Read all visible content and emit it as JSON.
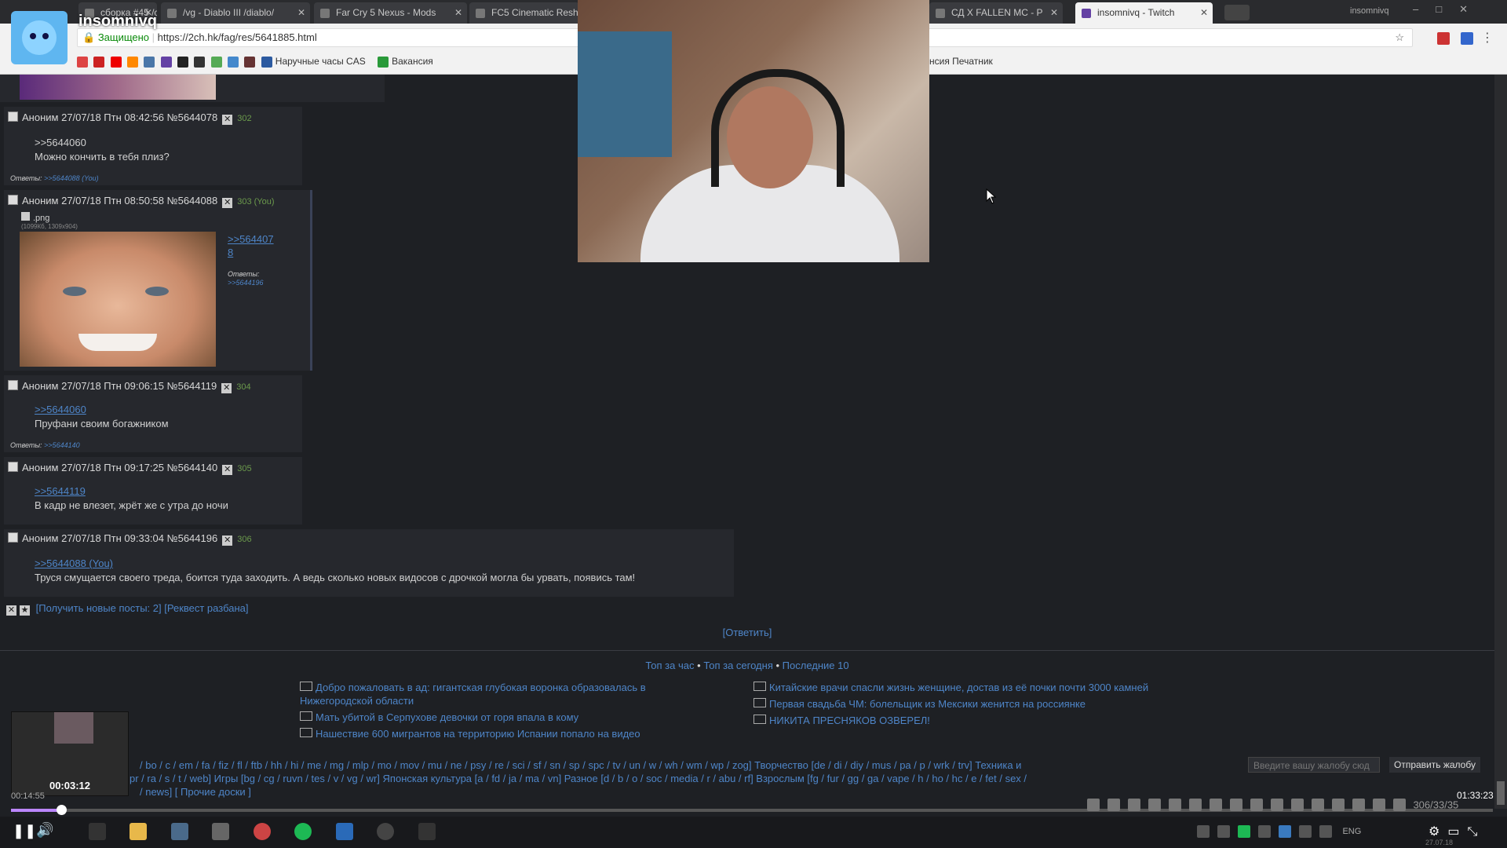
{
  "channel": {
    "name": "insomnivq"
  },
  "browser": {
    "tabs": [
      {
        "label": "сборка #45 /ch"
      },
      {
        "label": "/vg - Diablo III /diablo/"
      },
      {
        "label": "Far Cry 5 Nexus - Mods"
      },
      {
        "label": "FC5 Cinematic Reshad"
      },
      {
        "label": "СД X FALLEN MC - P"
      },
      {
        "label": "insomnivq - Twitch"
      }
    ],
    "window_user": "insomnivq",
    "secure_label": "Защищено",
    "url": "https://2ch.hk/fag/res/5641885.html",
    "bookmarks": [
      {
        "label": "Наручные часы CAS"
      },
      {
        "label": "Вакансия"
      },
      {
        "label": "нсия Печатник"
      }
    ]
  },
  "posts": [
    {
      "author": "Аноним",
      "date": "27/07/18 Птн 08:42:56",
      "id": "№5644078",
      "num": "302",
      "reply_link": ">>5644060",
      "text": "Можно кончить в тебя плиз?",
      "answers_label": "Ответы:",
      "answers": ">>5644088 (You)"
    },
    {
      "author": "Аноним",
      "date": "27/07/18 Птн 08:50:58",
      "id": "№5644088",
      "num": "303 (You)",
      "file_ext": ".png",
      "file_meta": "(1099Кб, 1309x904)",
      "reply_link_1": ">>564407",
      "reply_link_2": "8",
      "answers_label": "Ответы:",
      "answers": ">>5644196"
    },
    {
      "author": "Аноним",
      "date": "27/07/18 Птн 09:06:15",
      "id": "№5644119",
      "num": "304",
      "reply_link": ">>5644060",
      "text": "Пруфани своим богажником",
      "answers_label": "Ответы:",
      "answers": ">>5644140"
    },
    {
      "author": "Аноним",
      "date": "27/07/18 Птн 09:17:25",
      "id": "№5644140",
      "num": "305",
      "reply_link": ">>5644119",
      "text": "В кадр не влезет, жрёт же с утра до ночи"
    },
    {
      "author": "Аноним",
      "date": "27/07/18 Птн 09:33:04",
      "id": "№5644196",
      "num": "306",
      "reply_link": ">>5644088 (You)",
      "text": "Труся смущается своего треда, боится туда заходить. А ведь сколько новых видосов с дрочкой могла бы урвать, появись там!"
    }
  ],
  "thread_controls": {
    "new_posts": "[Получить новые посты: 2]",
    "ban_request": "[Реквест разбана]",
    "reply": "[Ответить]"
  },
  "top_nav": {
    "hour": "Топ за час",
    "today": "Топ за сегодня",
    "last10": "Последние 10",
    "sep": "•"
  },
  "news": {
    "left": [
      "Добро пожаловать в ад: гигантская глубокая воронка образовалась в Нижегородской области",
      "Мать убитой в Серпухове девочки от горя впала в кому",
      "Нашествие 600 мигрантов на территорию Испании попало на видео"
    ],
    "right": [
      "Китайские врачи спасли жизнь женщине, достав из её почки почти 3000 камней",
      "Первая свадьба ЧМ: болельщик из Мексики женится на россиянке",
      "НИКИТА ПРЕСНЯКОВ ОЗВЕРЕЛ!"
    ]
  },
  "boards": {
    "line1": "/ bo / c / em / fa / fiz / fl / ftb / hh / hi / me / mg / mlp / mo / mov / mu / ne / psy / re / sci / sf / sn / sp / spc / tv / un / w / wh / wm / wp / zog] Творчество [de / di / diy / mus / pa / p / wrk / trv] Техника и",
    "line2": "pr / ra / s / t / web] Игры [bg / cg / ruvn / tes / v / vg / wr] Японская культура [a / fd / ja / ma / vn] Разное [d / b / o / soc / media / r / abu / rf] Взрослым [fg / fur / gg / ga / vape / h / ho / hc / e / fet / sex /",
    "line3": "/ news] [ Прочие доски ]"
  },
  "complaint": {
    "placeholder": "Введите вашу жалобу сюд",
    "submit": "Отправить жалобу"
  },
  "player": {
    "current": "00:03:12",
    "total": "01:33:23",
    "progress": 0.034,
    "clock_left": "00:14:55",
    "counter": "306/33/35",
    "lang": "ENG",
    "date": "27.07.18"
  }
}
